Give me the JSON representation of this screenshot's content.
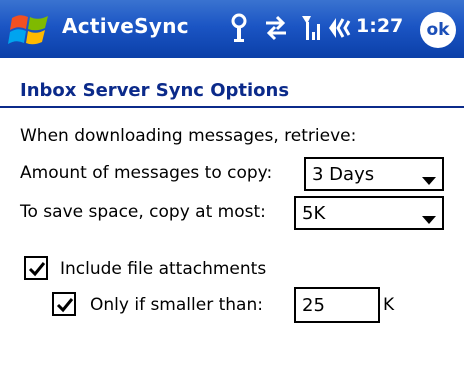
{
  "titlebar": {
    "app_title": "ActiveSync",
    "clock": "1:27",
    "ok_label": "ok",
    "icons": [
      "windows-logo",
      "connectivity-icon",
      "sync-icon",
      "signal-icon",
      "volume-icon"
    ]
  },
  "section": {
    "title": "Inbox Server Sync Options"
  },
  "options": {
    "intro": "When downloading messages, retrieve:",
    "amount_label": "Amount of messages to copy:",
    "amount_value": "3 Days",
    "size_label": "To save space, copy at most:",
    "size_value": "5K"
  },
  "attachments": {
    "include_label": "Include file attachments",
    "include_checked": true,
    "only_if_label": "Only if smaller than:",
    "only_if_checked": true,
    "size_limit": "25",
    "unit": "K"
  },
  "colors": {
    "titlebar": "#1b55c4",
    "section_title": "#0b2a8a"
  }
}
